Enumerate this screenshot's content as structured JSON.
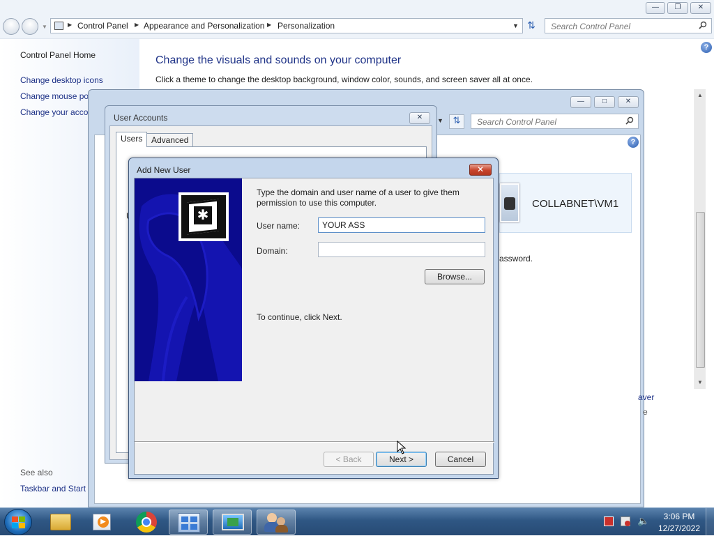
{
  "main_window": {
    "breadcrumb": [
      "Control Panel",
      "Appearance and Personalization",
      "Personalization"
    ],
    "search_placeholder": "Search Control Panel",
    "nav": {
      "home": "Control Panel Home",
      "links": [
        "Change desktop icons",
        "Change mouse po",
        "Change your acco"
      ],
      "see_also_label": "See also",
      "see_also_links": [
        "Taskbar and Start I"
      ]
    },
    "heading": "Change the visuals and sounds on your computer",
    "subtitle": "Click a theme to change the desktop background, window color, sounds, and screen saver all at once."
  },
  "window2": {
    "search_placeholder": "Search Control Panel",
    "account_name": "COLLABNET\\VM1",
    "password_fragment": "assword.",
    "screensaver_fragment": "aver",
    "fragment_e": "e"
  },
  "user_accounts": {
    "title": "User Accounts",
    "tabs": [
      "Users",
      "Advanced"
    ],
    "active_tab": "Users",
    "fragment_u": "U"
  },
  "add_new_user": {
    "title": "Add New User",
    "instruction": "Type the domain and user name of a user to give them permission to use this computer.",
    "user_name_label": "User name:",
    "user_name_value": "YOUR ASS",
    "domain_label": "Domain:",
    "domain_value": "",
    "browse_label": "Browse...",
    "continue_text": "To continue, click Next.",
    "back_label": "< Back",
    "next_label": "Next >",
    "cancel_label": "Cancel"
  },
  "taskbar": {
    "items": [
      "start-orb",
      "explorer",
      "media-player",
      "chrome",
      "control-panel",
      "remote-desktop",
      "user-accounts"
    ],
    "active_items": [
      "control-panel",
      "remote-desktop",
      "user-accounts"
    ],
    "time": "3:06 PM",
    "date": "12/27/2022"
  },
  "colors": {
    "link": "#1e3287",
    "heading": "#1e3287",
    "banner": "#0b0b8d",
    "taskbar": "#2f5784"
  }
}
